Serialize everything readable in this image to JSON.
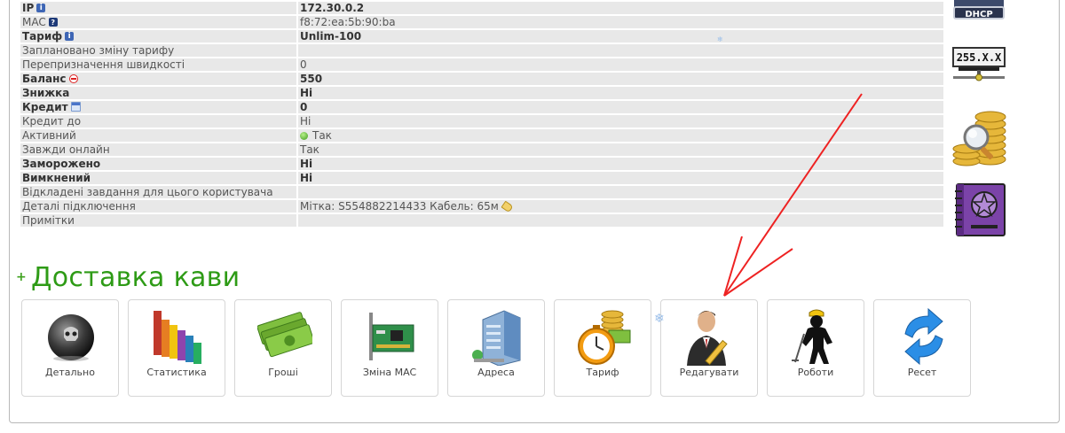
{
  "info_rows": [
    {
      "key": "IP",
      "key_bold": true,
      "icon": "info-icon",
      "value": "172.30.0.2",
      "value_bold": true
    },
    {
      "key": "MAC",
      "key_bold": false,
      "icon": "help-icon",
      "value": "f8:72:ea:5b:90:ba",
      "value_bold": false
    },
    {
      "key": "Тариф",
      "key_bold": true,
      "icon": "info-icon",
      "value": "Unlim-100",
      "value_bold": true
    },
    {
      "key": "Заплановано зміну тарифу",
      "key_bold": false,
      "icon": "",
      "value": "",
      "value_bold": false
    },
    {
      "key": "Перепризначення швидкості",
      "key_bold": false,
      "icon": "",
      "value": "0",
      "value_bold": false
    },
    {
      "key": "Баланс",
      "key_bold": true,
      "icon": "minus-circle-icon",
      "value": "550",
      "value_bold": true
    },
    {
      "key": "Знижка",
      "key_bold": true,
      "icon": "",
      "value": "Ні",
      "value_bold": true
    },
    {
      "key": "Кредит",
      "key_bold": true,
      "icon": "calendar-icon",
      "value": "0",
      "value_bold": true
    },
    {
      "key": "Кредит до",
      "key_bold": false,
      "icon": "",
      "value": "Ні",
      "value_bold": false
    },
    {
      "key": "Активний",
      "key_bold": false,
      "icon": "",
      "value": "Так",
      "value_bold": false,
      "value_icon": "green-dot-icon"
    },
    {
      "key": "Завжди онлайн",
      "key_bold": false,
      "icon": "",
      "value": "Так",
      "value_bold": false
    },
    {
      "key": "Заморожено",
      "key_bold": true,
      "icon": "",
      "value": "Ні",
      "value_bold": true
    },
    {
      "key": "Вимкнений",
      "key_bold": true,
      "icon": "",
      "value": "Ні",
      "value_bold": true
    },
    {
      "key": "Відкладені завдання для цього користувача",
      "key_bold": false,
      "icon": "",
      "value": "",
      "value_bold": false
    },
    {
      "key": "Деталі підключення",
      "key_bold": false,
      "icon": "",
      "value": "Мітка: S554882214433 Кабель: 65м",
      "value_bold": false,
      "value_icon_after": "tag-icon"
    },
    {
      "key": "Примітки",
      "key_bold": false,
      "icon": "",
      "value": "",
      "value_bold": false
    }
  ],
  "side_icons": {
    "dhcp_label": "DHCP",
    "netmask_label": "255.X.X"
  },
  "section": {
    "title": "Доставка кави",
    "toggle_symbol": "+"
  },
  "tiles": [
    {
      "name": "details",
      "label": "Детально",
      "icon": "skull-sphere-icon"
    },
    {
      "name": "statistics",
      "label": "Статистика",
      "icon": "bar-chart-icon"
    },
    {
      "name": "money",
      "label": "Гроші",
      "icon": "money-icon"
    },
    {
      "name": "change-mac",
      "label": "Зміна MAC",
      "icon": "network-card-icon"
    },
    {
      "name": "address",
      "label": "Адреса",
      "icon": "building-icon"
    },
    {
      "name": "tariff",
      "label": "Тариф",
      "icon": "stopwatch-coins-icon"
    },
    {
      "name": "edit",
      "label": "Редагувати",
      "icon": "user-edit-icon"
    },
    {
      "name": "robots",
      "label": "Роботи",
      "icon": "worker-icon"
    },
    {
      "name": "reset",
      "label": "Ресет",
      "icon": "refresh-icon"
    }
  ],
  "colors": {
    "accent_green": "#2e9b16",
    "row_bg": "#e8e8e8",
    "annotation_arrow": "#ee2222"
  }
}
